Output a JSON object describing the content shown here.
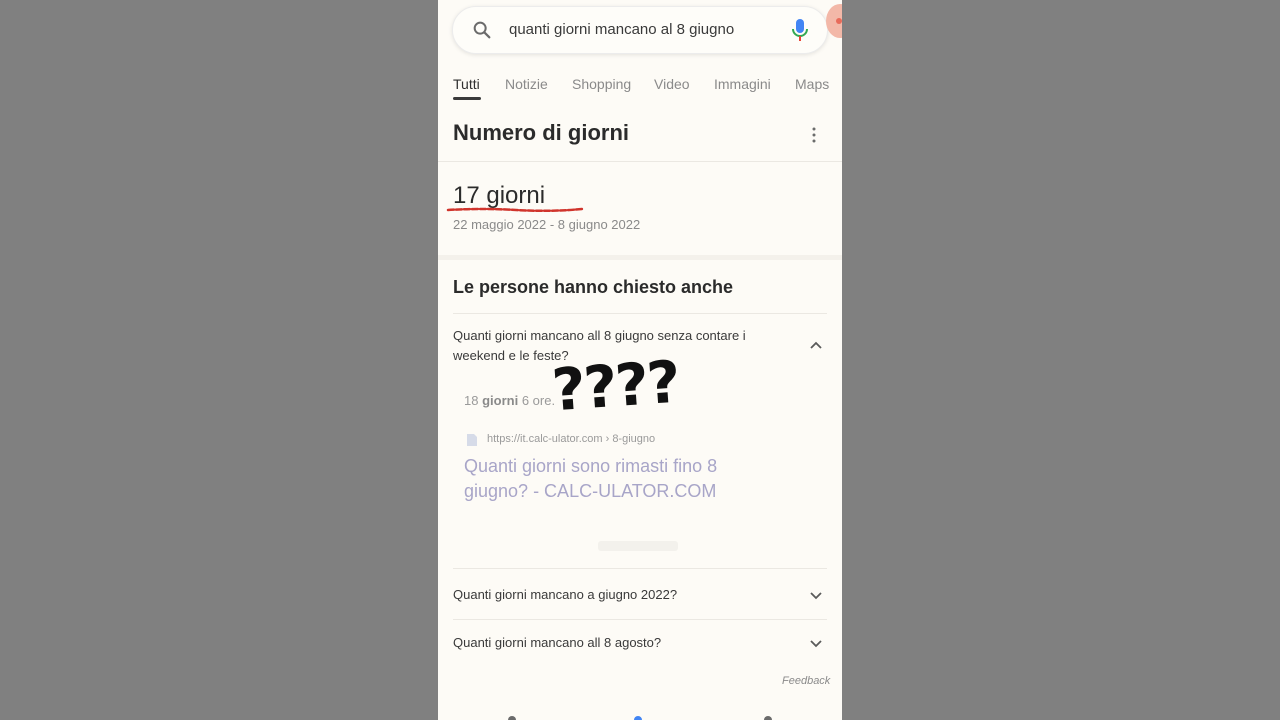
{
  "search": {
    "query": "quanti giorni mancano al 8 giugno"
  },
  "tabs": [
    {
      "label": "Tutti",
      "active": true
    },
    {
      "label": "Notizie",
      "active": false
    },
    {
      "label": "Shopping",
      "active": false
    },
    {
      "label": "Video",
      "active": false
    },
    {
      "label": "Immagini",
      "active": false
    },
    {
      "label": "Maps",
      "active": false
    }
  ],
  "card": {
    "title": "Numero di giorni",
    "result": "17 giorni",
    "range": "22 maggio 2022 - 8 giugno 2022"
  },
  "paa": {
    "title": "Le persone hanno chiesto anche",
    "q1": "Quanti giorni mancano all 8 giugno senza contare i weekend e le feste?",
    "answer_value": "18",
    "answer_bold": "giorni",
    "answer_rest": "6 ore.",
    "annotation": "????",
    "source_url": "https://it.calc-ulator.com › 8-giugno",
    "source_title": "Quanti giorni sono rimasti fino 8 giugno? - CALC-ULATOR.COM",
    "q2": "Quanti giorni mancano a giugno 2022?",
    "q3": "Quanti giorni mancano all 8 agosto?"
  },
  "feedback": "Feedback",
  "colors": {
    "background": "#808080",
    "page": "#fdfbf6",
    "underline_mark": "#d0342c",
    "link": "#a8a5c8"
  }
}
